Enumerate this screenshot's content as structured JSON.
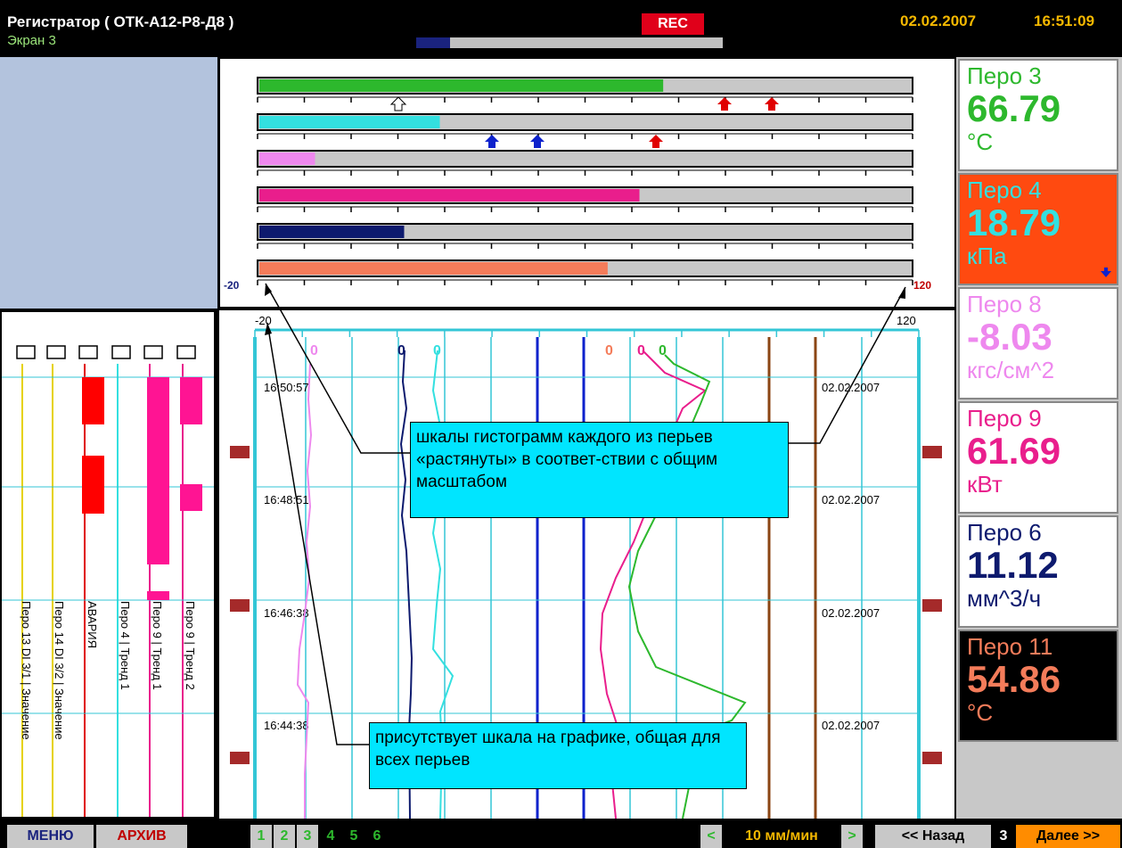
{
  "header": {
    "title": "Регистратор ( ОТК-А12-Р8-Д8 )",
    "screen": "Экран 3",
    "rec": "REC",
    "progress_fraction": 0.11,
    "date": "02.02.2007",
    "time": "16:51:09"
  },
  "histogram": {
    "scale_min": "-20",
    "scale_max": "120",
    "bars": [
      {
        "color": "#2db82d",
        "value": 66.79
      },
      {
        "color": "#33e0e0",
        "value": 18.79
      },
      {
        "color": "#ee88ee",
        "value": -8.03
      },
      {
        "color": "#e91e8c",
        "value": 61.69
      },
      {
        "color": "#0d1a6e",
        "value": 11.12
      },
      {
        "color": "#f47c5a",
        "value": 54.86
      }
    ]
  },
  "events": {
    "channels": [
      {
        "label": "Перо 13 DI 3/1 | Значение",
        "color": "#e6d200"
      },
      {
        "label": "Перо 14 DI 3/2 | Значение",
        "color": "#e6d200"
      },
      {
        "label": "АВАРИЯ",
        "color": "#e00000"
      },
      {
        "label": "Перо 4 | Тренд 1",
        "color": "#33e0e0"
      },
      {
        "label": "Перо 9 | Тренд 1",
        "color": "#e91e8c"
      },
      {
        "label": "Перо 9 | Тренд 2",
        "color": "#e91e8c"
      }
    ]
  },
  "chart": {
    "scale_min": "-20",
    "scale_max": "120",
    "rows": [
      {
        "time": "16:50:57",
        "date": "02.02.2007"
      },
      {
        "time": "16:48:51",
        "date": "02.02.2007"
      },
      {
        "time": "16:46:38",
        "date": "02.02.2007"
      },
      {
        "time": "16:44:38",
        "date": "02.02.2007"
      }
    ],
    "markers": [
      "0",
      "0",
      "0",
      "0",
      "0",
      "0",
      "0"
    ]
  },
  "pens": [
    {
      "name": "Перо 3",
      "value": "66.79",
      "unit": "°C",
      "bg": "#ffffff",
      "fg": "#2db82d"
    },
    {
      "name": "Перо 4",
      "value": "18.79",
      "unit": "кПа",
      "bg": "#ff4a10",
      "fg": "#33e0e0"
    },
    {
      "name": "Перо 8",
      "value": "-8.03",
      "unit": "кгс/см^2",
      "bg": "#ffffff",
      "fg": "#ee88ee"
    },
    {
      "name": "Перо 9",
      "value": "61.69",
      "unit": "кВт",
      "bg": "#ffffff",
      "fg": "#e91e8c"
    },
    {
      "name": "Перо 6",
      "value": "11.12",
      "unit": "мм^3/ч",
      "bg": "#ffffff",
      "fg": "#0d1a6e"
    },
    {
      "name": "Перо 11",
      "value": "54.86",
      "unit": "°C",
      "bg": "#000000",
      "fg": "#f47c5a"
    }
  ],
  "annotations": {
    "scales_note": "шкалы гистограмм каждого из перьев «растянуты» в соответ-ствии с общим масштабом",
    "common_scale_note": "присутствует шкала на графике, общая для всех перьев"
  },
  "footer": {
    "menu": "МЕНЮ",
    "archive": "АРХИВ",
    "screens": [
      "1",
      "2",
      "3",
      "4",
      "5",
      "6"
    ],
    "speed_prev": "<",
    "speed": "10 мм/мин",
    "speed_next": ">",
    "back": "<< Назад",
    "page": "3",
    "next": "Далее >>"
  }
}
